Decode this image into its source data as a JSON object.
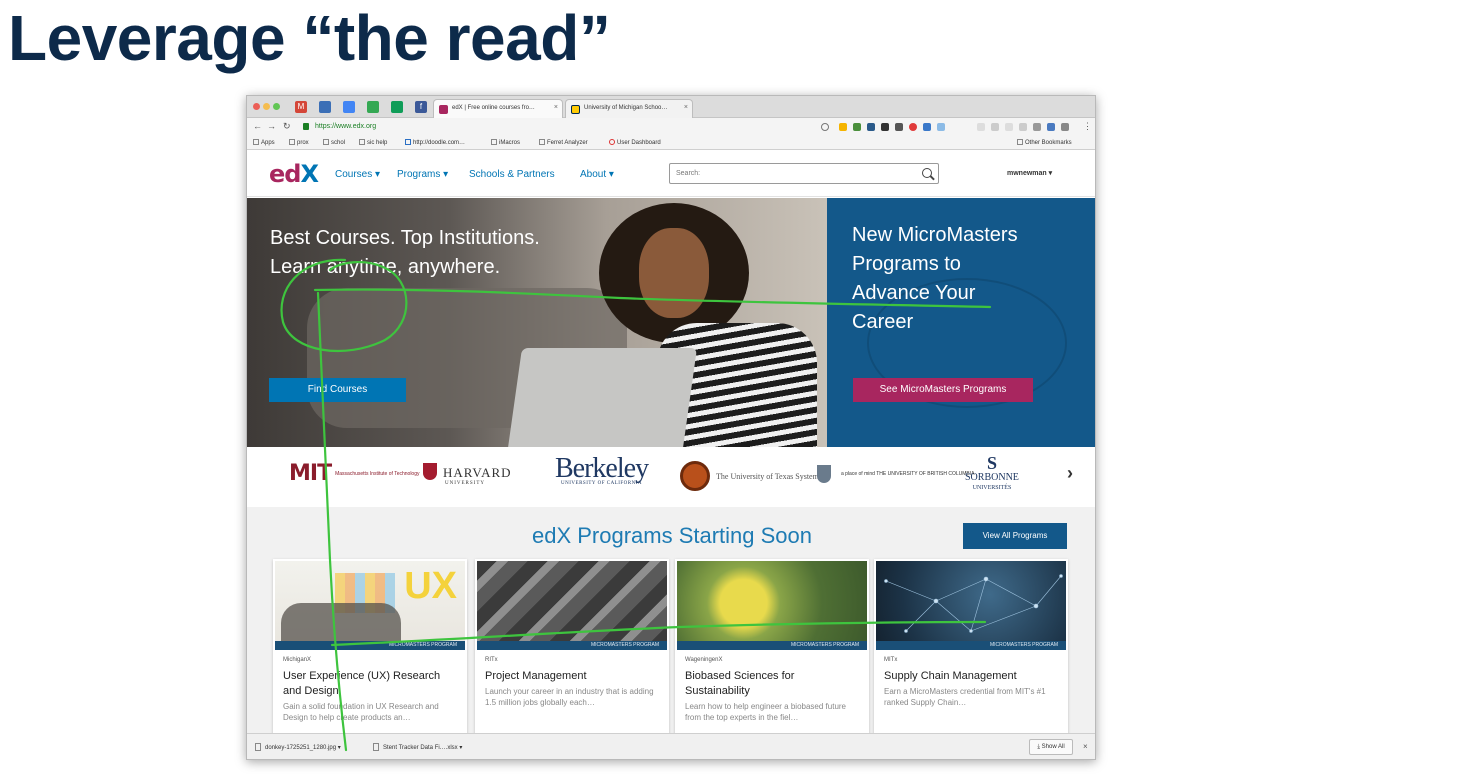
{
  "slide": {
    "title": "Leverage “the read”"
  },
  "browser": {
    "tabs": [
      {
        "title": "edX | Free online courses fro…"
      },
      {
        "title": "University of Michigan Schoo…"
      }
    ],
    "url": "https://www.edx.org",
    "bookmarks": [
      "Apps",
      "prox",
      "schol",
      "sic help",
      "http://doodle.com…",
      "iMacros",
      "Ferret Analyzer",
      "User Dashboard"
    ],
    "other_bookmarks": "Other Bookmarks"
  },
  "edx": {
    "logo_prefix": "ed",
    "logo_x": "X",
    "nav": [
      {
        "label": "Courses ▾"
      },
      {
        "label": "Programs ▾"
      },
      {
        "label": "Schools & Partners"
      },
      {
        "label": "About ▾"
      }
    ],
    "search_placeholder": "Search:",
    "username": "mwnewman ▾",
    "hero": {
      "line1": "Best Courses. Top Institutions.",
      "line2": "Learn anytime, anywhere.",
      "cta": "Find Courses"
    },
    "promo": {
      "line1": "New MicroMasters",
      "line2": "Programs to",
      "line3": "Advance Your",
      "line4": "Career",
      "cta": "See MicroMasters Programs"
    },
    "partners": {
      "mit_mark": "MIT",
      "mit_text": "Massachusetts Institute of Technology",
      "harvard": "HARVARD",
      "harvard_sub": "UNIVERSITY",
      "berkeley": "Berkeley",
      "berkeley_sub": "UNIVERSITY OF CALIFORNIA",
      "ut": "The University of Texas System",
      "ubc": "a place of mind THE UNIVERSITY OF BRITISH COLUMBIA",
      "sorbonne_mark": "S",
      "sorbonne": "SORBONNE",
      "sorbonne_sub": "UNIVERSITÉS"
    },
    "programs": {
      "title": "edX Programs Starting Soon",
      "view_all": "View All Programs",
      "cards": [
        {
          "ribbon": "MICROMASTERS PROGRAM",
          "org": "MichiganX",
          "title": "User Experience (UX) Research and Design",
          "desc": "Gain a solid foundation in UX Research and Design to help create products an…",
          "image_text": "UX"
        },
        {
          "ribbon": "MICROMASTERS PROGRAM",
          "org": "RITx",
          "title": "Project Management",
          "desc": "Launch your career in an industry that is adding 1.5 million jobs globally each…"
        },
        {
          "ribbon": "MICROMASTERS PROGRAM",
          "org": "WageningenX",
          "title": "Biobased Sciences for Sustainability",
          "desc": "Learn how to help engineer a biobased future from the top experts in the fiel…"
        },
        {
          "ribbon": "MICROMASTERS PROGRAM",
          "org": "MITx",
          "title": "Supply Chain Management",
          "desc": "Earn a MicroMasters credential from MIT's #1 ranked Supply Chain…"
        }
      ]
    }
  },
  "downloads": {
    "items": [
      "donkey-1725251_1280.jpg",
      "Stent Tracker Data Fi….xlsx"
    ],
    "show_all": "Show All"
  },
  "colors": {
    "title": "#0d2a4a",
    "edx_blue": "#0075b4",
    "edx_pink": "#a8265f",
    "promo_bg": "#13588a",
    "annotation": "#3ec43e"
  }
}
